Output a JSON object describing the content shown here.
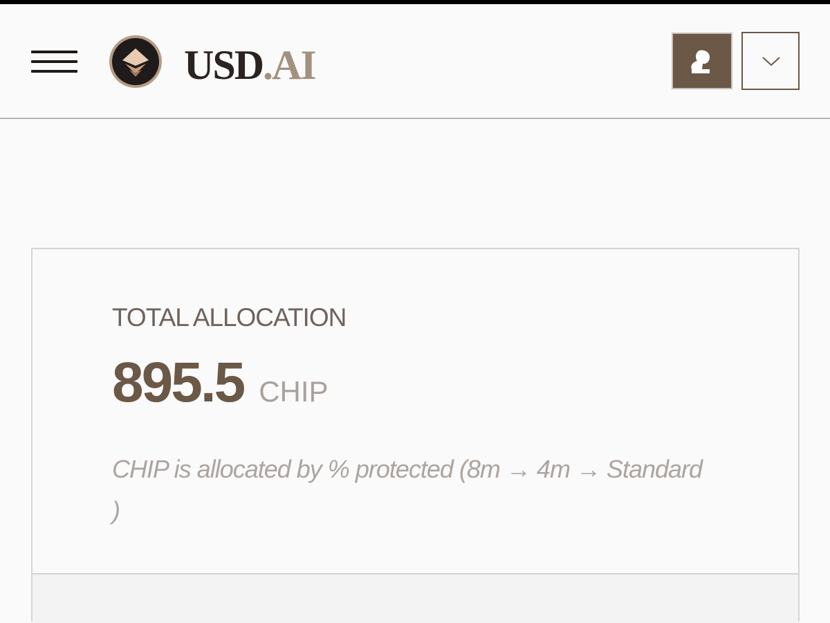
{
  "header": {
    "brand_primary": "USD",
    "brand_accent": ".AI",
    "icons": {
      "menu": "hamburger-menu-icon",
      "logo": "pyramid-logo-icon",
      "profile": "profile-avatar-icon",
      "dropdown": "chevron-down-icon"
    }
  },
  "allocation": {
    "label": "TOTAL ALLOCATION",
    "value": "895.5",
    "unit": "CHIP",
    "note": "CHIP is allocated by % protected (8m → 4m → Standard )"
  },
  "colors": {
    "accent": "#6b5847",
    "accent_light": "#a39180",
    "text_dark": "#2a2320",
    "background": "#fafafa"
  }
}
